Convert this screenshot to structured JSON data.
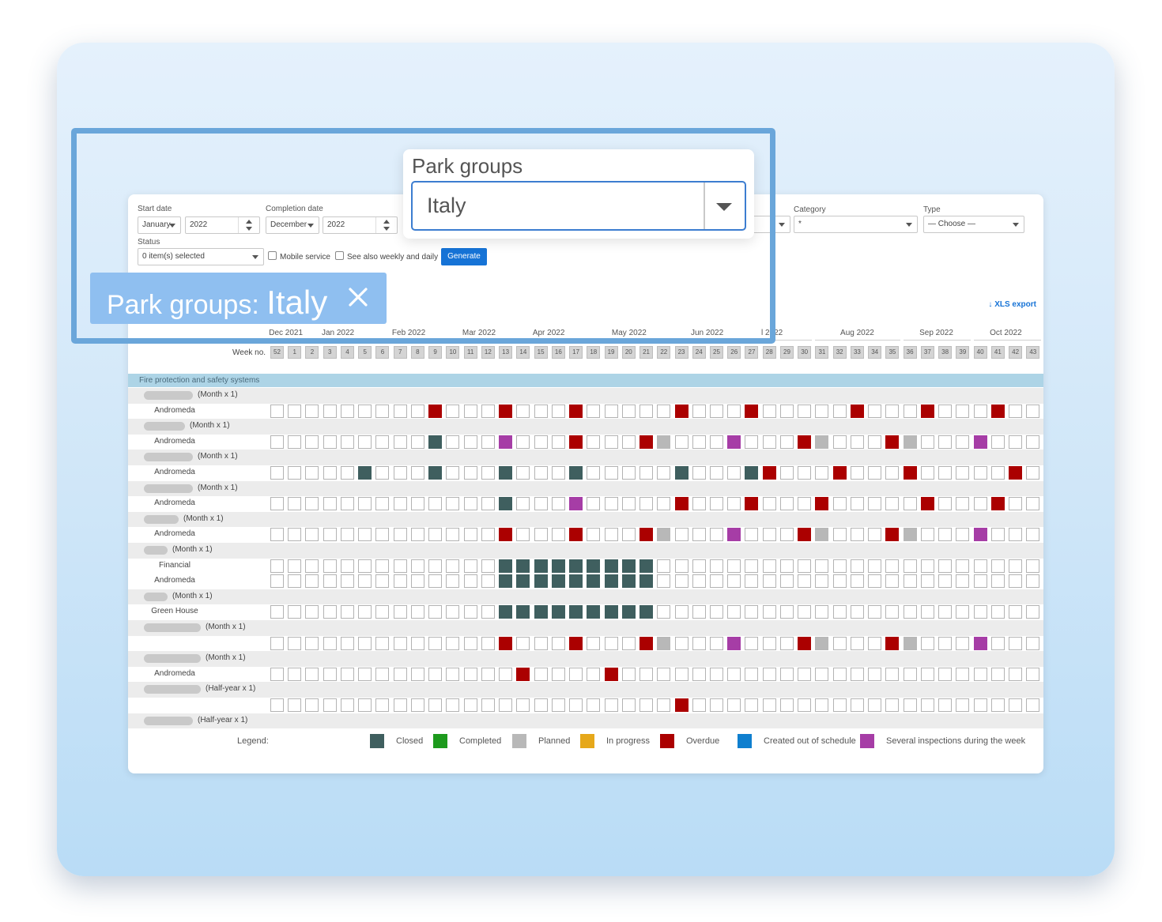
{
  "filters": {
    "start_date": {
      "label": "Start date",
      "month": "January",
      "year": "2022"
    },
    "completion_date": {
      "label": "Completion date",
      "month": "December",
      "year": "2022"
    },
    "category": {
      "label": "Category",
      "value": "*"
    },
    "type": {
      "label": "Type",
      "value": "— Choose —"
    },
    "status": {
      "label": "Status",
      "value": "0 item(s) selected"
    },
    "mobile_service": {
      "label": "Mobile service",
      "checked": false
    },
    "weekly_daily": {
      "label": "See also weekly and daily",
      "checked": false
    },
    "generate_label": "Generate",
    "xls_export_label": "XLS export"
  },
  "park_groups": {
    "title": "Park groups",
    "value": "Italy"
  },
  "filter_chip": {
    "label": "Park groups:",
    "value": "Italy"
  },
  "timeline": {
    "week_label": "Week no.",
    "months": [
      {
        "label": "Dec 2021",
        "start": 0
      },
      {
        "label": "Jan 2022",
        "start": 2
      },
      {
        "label": "Feb 2022",
        "start": 6
      },
      {
        "label": "Mar 2022",
        "start": 10
      },
      {
        "label": "Apr 2022",
        "start": 14
      },
      {
        "label": "May 2022",
        "start": 18
      },
      {
        "label": "Jun 2022",
        "start": 23
      },
      {
        "label": "l 2022",
        "start": 27
      },
      {
        "label": "Aug 2022",
        "start": 31
      },
      {
        "label": "Sep 2022",
        "start": 36
      },
      {
        "label": "Oct 2022",
        "start": 40
      }
    ],
    "weeks": [
      "52",
      "1",
      "2",
      "3",
      "4",
      "5",
      "6",
      "7",
      "8",
      "9",
      "10",
      "11",
      "12",
      "13",
      "14",
      "15",
      "16",
      "17",
      "18",
      "19",
      "20",
      "21",
      "22",
      "23",
      "24",
      "25",
      "26",
      "27",
      "28",
      "29",
      "30",
      "31",
      "32",
      "33",
      "34",
      "35",
      "36",
      "37",
      "38",
      "39",
      "40",
      "41",
      "42",
      "43"
    ]
  },
  "status_colors": {
    "C": "#3f5f5f",
    "O": "#ab0000",
    "P": "#b8b8b8",
    "M": "#a63da6",
    "G": "#1d9a1d",
    "I": "#e6a81a",
    "S": "#0f7fcf"
  },
  "section": {
    "title": "Fire protection and safety systems"
  },
  "rows": [
    {
      "type": "header",
      "pill": 62,
      "label": "(Month x 1)"
    },
    {
      "type": "data",
      "label": "Andromeda",
      "cells": "_________O___O___O_____O___O_____O___O___O____"
    },
    {
      "type": "header",
      "pill": 52,
      "label": "(Month x 1)"
    },
    {
      "type": "data",
      "label": "Andromeda",
      "cells": "_________C___M___O___OP___M___OP___OP___M____O"
    },
    {
      "type": "header",
      "pill": 62,
      "label": "(Month x 1)"
    },
    {
      "type": "data",
      "label": "Andromeda",
      "cells": "_____C___C___C___C_____C___CO___O___O_____O___"
    },
    {
      "type": "header",
      "pill": 62,
      "label": "(Month x 1)"
    },
    {
      "type": "data",
      "label": "Andromeda",
      "cells": "_____________C___M_____O___O___O_____O___O____"
    },
    {
      "type": "header",
      "pill": 44,
      "label": "(Month x 1)"
    },
    {
      "type": "data",
      "label": "Andromeda",
      "cells": "_____________O___O___OP___M___OP___OP___M____O"
    },
    {
      "type": "header",
      "pill": 30,
      "label": "(Month x 1)"
    },
    {
      "type": "data",
      "label": "Financial",
      "cells": "_____________CCCCCCCCC______________________"
    },
    {
      "type": "data",
      "label": "Andromeda",
      "cells": "_____________CCCCCCCCC______________________"
    },
    {
      "type": "header",
      "pill": 30,
      "label": "(Month x 1)"
    },
    {
      "type": "data",
      "label": "Green House",
      "cells": "_____________CCCCCCCCC______________________"
    },
    {
      "type": "header",
      "pill": 72,
      "label": "(Month x 1)"
    },
    {
      "type": "data",
      "label": "",
      "cells": "_____________O___O___OP___M___OP___OP___M____O"
    },
    {
      "type": "header",
      "pill": 72,
      "label": "(Month x 1)"
    },
    {
      "type": "data",
      "label": "Andromeda",
      "cells": "______________O____O________________________"
    },
    {
      "type": "header",
      "pill": 72,
      "label": "(Half-year x 1)"
    },
    {
      "type": "data",
      "label": "",
      "cells": "_______________________O____________________"
    },
    {
      "type": "header",
      "pill": 62,
      "label": "(Half-year x 1)"
    }
  ],
  "legend": {
    "label": "Legend:",
    "items": [
      {
        "name": "Closed",
        "color": "#3f5f5f"
      },
      {
        "name": "Completed",
        "color": "#1d9a1d"
      },
      {
        "name": "Planned",
        "color": "#b8b8b8"
      },
      {
        "name": "In progress",
        "color": "#e6a81a"
      },
      {
        "name": "Overdue",
        "color": "#ab0000"
      },
      {
        "name": "Created out of schedule",
        "color": "#0f7fcf"
      },
      {
        "name": "Several inspections during the week",
        "color": "#a63da6"
      }
    ]
  }
}
